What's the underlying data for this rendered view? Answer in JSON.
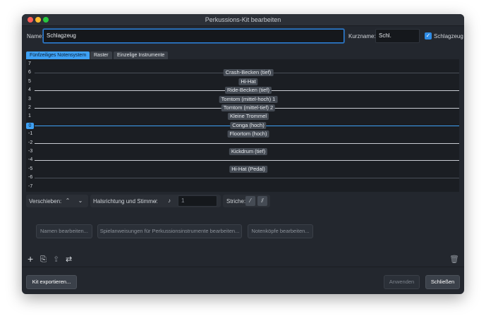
{
  "window": {
    "title": "Perkussions-Kit bearbeiten"
  },
  "header": {
    "name_label": "Name:",
    "name_value": "Schlagzeug",
    "short_name_label": "Kurzname:",
    "short_name_value": "Schl.",
    "drumset_checkbox_label": "Schlagzeug",
    "drumset_checked": true
  },
  "tabs": [
    {
      "label": "Fünfzeiliges Notensystem",
      "active": true
    },
    {
      "label": "Raster",
      "active": false
    },
    {
      "label": "Einzelige Instrumente",
      "active": false
    }
  ],
  "staff": {
    "selected_position": "0",
    "positions": [
      "7",
      "6",
      "5",
      "4",
      "3",
      "2",
      "1",
      "0",
      "-1",
      "-2",
      "-3",
      "-4",
      "-5",
      "-6",
      "-7"
    ],
    "instruments": [
      {
        "position": "6",
        "name": "Crash-Becken (tief)"
      },
      {
        "position": "5",
        "name": "Hi-Hat"
      },
      {
        "position": "4",
        "name": "Ride-Becken (tief)"
      },
      {
        "position": "3",
        "name": "Tomtom (mittel-hoch) 1"
      },
      {
        "position": "2",
        "name": "Tomtom (mittel-tief) 2"
      },
      {
        "position": "1",
        "name": "Kleine Trommel"
      },
      {
        "position": "0",
        "name": "Conga (hoch)"
      },
      {
        "position": "-1",
        "name": "Floortom (hoch)"
      },
      {
        "position": "-3",
        "name": "Kickdrum (tief)"
      },
      {
        "position": "-5",
        "name": "Hi-Hat (Pedal)"
      }
    ]
  },
  "controls": {
    "move_label": "Verschieben:",
    "move_up_icon": "chevron-up-icon",
    "move_down_icon": "chevron-down-icon",
    "stem_label": "Halsrichtung und Stimme:",
    "voice_value": "1",
    "strokes_label": "Striche:"
  },
  "actions": {
    "edit_names": "Namen bearbeiten...",
    "edit_instructions": "Spielanweisungen für Perkussionsinstrumente bearbeiten...",
    "edit_noteheads": "Notenköpfe bearbeiten..."
  },
  "toolbar": {
    "add_icon": "plus-icon",
    "import_icon": "import-icon",
    "export_icon": "export-icon",
    "swap_icon": "swap-icon",
    "delete_icon": "trash-icon"
  },
  "footer": {
    "export_kit": "Kit exportieren...",
    "apply": "Anwenden",
    "close": "Schließen"
  }
}
